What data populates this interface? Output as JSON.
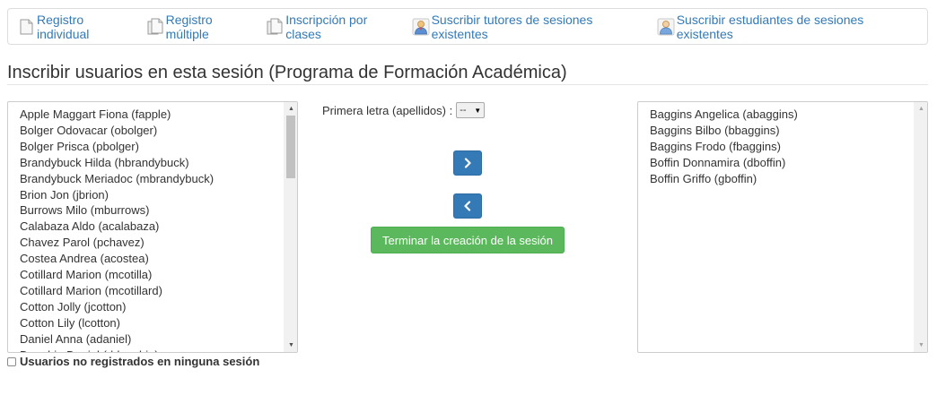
{
  "toolbar": {
    "items": [
      {
        "label": "Registro individual",
        "icon": "single-page-icon"
      },
      {
        "label": "Registro múltiple",
        "icon": "multiple-pages-icon"
      },
      {
        "label": "Inscripción por clases",
        "icon": "multiple-pages-icon"
      },
      {
        "label": "Suscribir tutores de sesiones existentes",
        "icon": "tutor-user-icon"
      },
      {
        "label": "Suscribir estudiantes de sesiones existentes",
        "icon": "student-user-icon"
      }
    ]
  },
  "page": {
    "title": "Inscribir usuarios en esta sesión (Programa de Formación Académica)"
  },
  "filter": {
    "label": "Primera letra (apellidos) :",
    "selected": "--"
  },
  "available_users": [
    "Apple Maggart Fiona (fapple)",
    "Bolger Odovacar (obolger)",
    "Bolger Prisca (pbolger)",
    "Brandybuck Hilda (hbrandybuck)",
    "Brandybuck Meriadoc (mbrandybuck)",
    "Brion Jon (jbrion)",
    "Burrows Milo (mburrows)",
    "Calabaza Aldo (acalabaza)",
    "Chavez Parol (pchavez)",
    "Costea Andrea (acostea)",
    "Cotillard Marion (mcotilla)",
    "Cotillard Marion (mcotillard)",
    "Cotton Jolly (jcotton)",
    "Cotton Lily (lcotton)",
    "Daniel Anna (adaniel)",
    "Dauphin Daniel (ddauphin)"
  ],
  "session_users": [
    "Baggins Angelica (abaggins)",
    "Baggins Bilbo (bbaggins)",
    "Baggins Frodo (fbaggins)",
    "Boffin Donnamira (dboffin)",
    "Boffin Griffo (gboffin)"
  ],
  "actions": {
    "finish_label": "Terminar la creación de la sesión"
  },
  "checkbox": {
    "label": "Usuarios no registrados en ninguna sesión",
    "checked": false
  },
  "colors": {
    "link": "#337ab7",
    "primary": "#337ab7",
    "success": "#5cb85c"
  }
}
